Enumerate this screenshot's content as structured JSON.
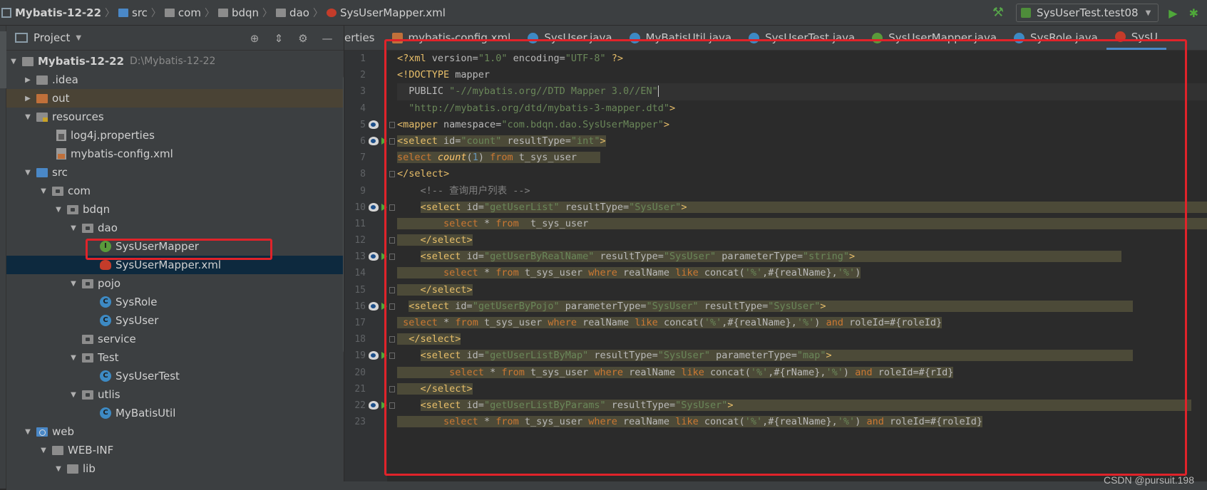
{
  "breadcrumb": {
    "items": [
      "Mybatis-12-22",
      "src",
      "com",
      "bdqn",
      "dao",
      "SysUserMapper.xml"
    ]
  },
  "toolbar": {
    "run_config": "SysUserTest.test08"
  },
  "project_panel": {
    "title": "Project",
    "tree": [
      {
        "label": "Mybatis-12-22",
        "path": "D:\\Mybatis-12-22"
      },
      {
        "label": ".idea"
      },
      {
        "label": "out"
      },
      {
        "label": "resources"
      },
      {
        "label": "log4j.properties"
      },
      {
        "label": "mybatis-config.xml"
      },
      {
        "label": "src"
      },
      {
        "label": "com"
      },
      {
        "label": "bdqn"
      },
      {
        "label": "dao"
      },
      {
        "label": "SysUserMapper"
      },
      {
        "label": "SysUserMapper.xml"
      },
      {
        "label": "pojo"
      },
      {
        "label": "SysRole"
      },
      {
        "label": "SysUser"
      },
      {
        "label": "service"
      },
      {
        "label": "Test"
      },
      {
        "label": "SysUserTest"
      },
      {
        "label": "utlis"
      },
      {
        "label": "MyBatisUtil"
      },
      {
        "label": "web"
      },
      {
        "label": "WEB-INF"
      },
      {
        "label": "lib"
      }
    ]
  },
  "tabs": [
    "erties",
    "mybatis-config.xml",
    "SysUser.java",
    "MyBatisUtil.java",
    "SysUserTest.java",
    "SysUserMapper.java",
    "SysRole.java",
    "SysU"
  ],
  "editor": {
    "line_numbers": [
      "1",
      "2",
      "3",
      "4",
      "5",
      "6",
      "7",
      "8",
      "9",
      "10",
      "11",
      "12",
      "13",
      "14",
      "15",
      "16",
      "17",
      "18",
      "19",
      "20",
      "21",
      "22",
      "23"
    ]
  },
  "watermark": "CSDN @pursuit.198",
  "colors": {
    "highlight_box": "#e0232a",
    "sql_highlight": "#4c4a38",
    "selection": "#0d293e"
  }
}
